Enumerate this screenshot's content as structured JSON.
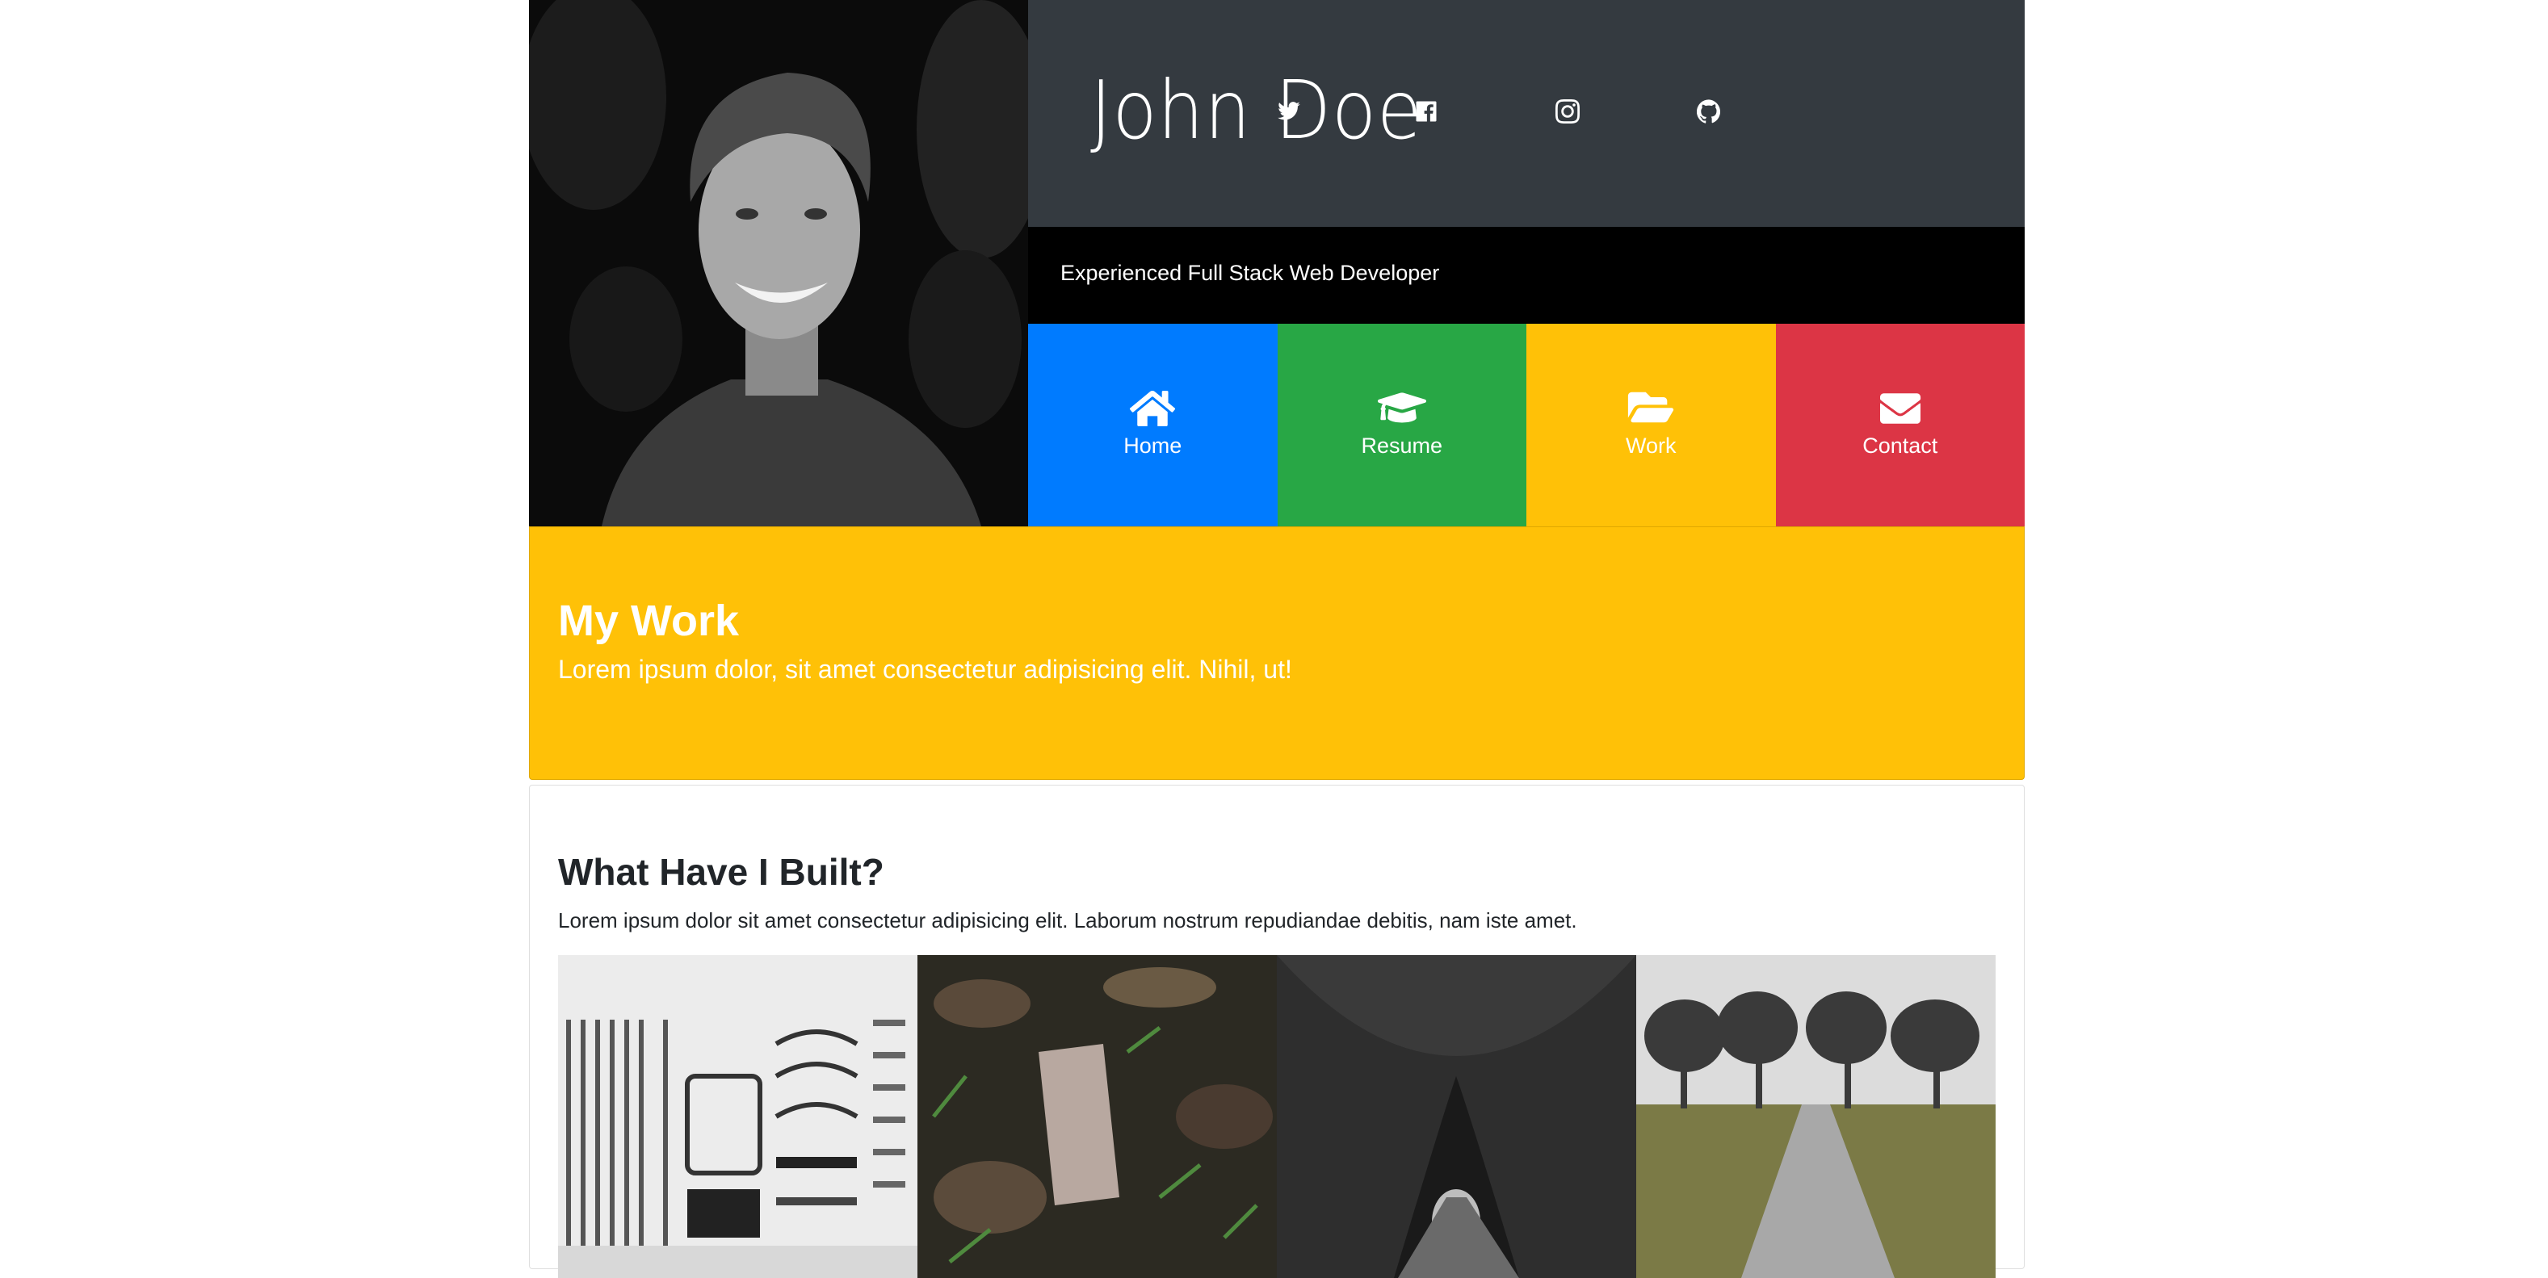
{
  "header": {
    "name": "John Doe",
    "tagline": "Experienced Full Stack Web Developer",
    "social": [
      "twitter-icon",
      "facebook-icon",
      "instagram-icon",
      "github-icon"
    ]
  },
  "nav": [
    {
      "label": "Home",
      "icon": "home-icon",
      "color": "#007bff"
    },
    {
      "label": "Resume",
      "icon": "graduation-cap-icon",
      "color": "#28a745"
    },
    {
      "label": "Work",
      "icon": "folder-open-icon",
      "color": "#ffc107"
    },
    {
      "label": "Contact",
      "icon": "envelope-icon",
      "color": "#dc3545"
    }
  ],
  "work": {
    "title": "My Work",
    "subtitle": "Lorem ipsum dolor, sit amet consectetur adipisicing elit. Nihil, ut!"
  },
  "built": {
    "title": "What Have I Built?",
    "text": "Lorem ipsum dolor sit amet consectetur adipisicing elit. Laborum nostrum repudiandae debitis, nam iste amet."
  }
}
